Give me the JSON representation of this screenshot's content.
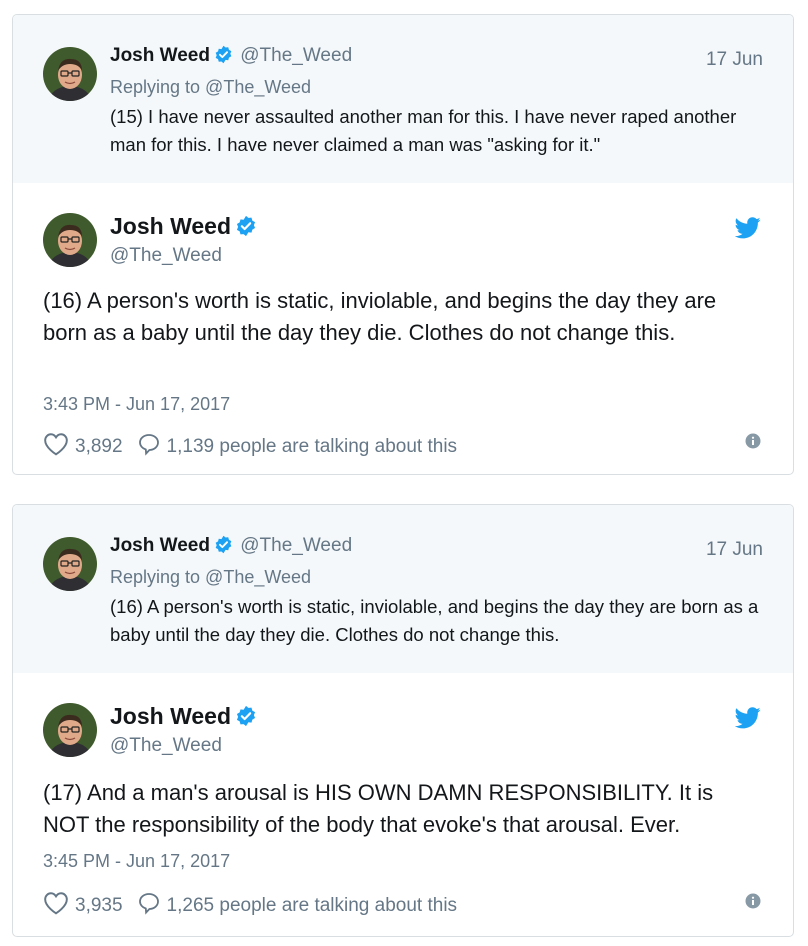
{
  "colors": {
    "accent": "#1da1f2",
    "muted": "#657786",
    "text": "#14171a",
    "reply_bg": "#f5f8fa",
    "border": "#d8dee2"
  },
  "icons": [
    "verified-badge-icon",
    "twitter-bird-icon",
    "heart-icon",
    "comment-bubble-icon",
    "info-icon"
  ],
  "embeds": [
    {
      "reply": {
        "name": "Josh Weed",
        "handle": "@The_Weed",
        "date": "17 Jun",
        "replying_to": "Replying to @The_Weed",
        "text": "(15) I have never assaulted another man for this. I have never raped another man for this. I have never claimed a man was \"asking for it.\""
      },
      "tweet": {
        "name": "Josh Weed",
        "handle": "@The_Weed",
        "text": "(16) A person's worth is static, inviolable, and begins the day they are born as a baby until the day they die. Clothes do not change this.",
        "timestamp": "3:43 PM - Jun 17, 2017",
        "likes": "3,892",
        "talking": "1,139 people are talking about this"
      }
    },
    {
      "reply": {
        "name": "Josh Weed",
        "handle": "@The_Weed",
        "date": "17 Jun",
        "replying_to": "Replying to @The_Weed",
        "text": "(16) A person's worth is static, inviolable, and begins the day they are born as a baby until the day they die. Clothes do not change this."
      },
      "tweet": {
        "name": "Josh Weed",
        "handle": "@The_Weed",
        "text": "(17) And a man's arousal is HIS OWN DAMN RESPONSIBILITY. It is NOT the responsibility of the body that evoke's that arousal. Ever.",
        "timestamp": "3:45 PM - Jun 17, 2017",
        "likes": "3,935",
        "talking": "1,265 people are talking about this"
      }
    }
  ]
}
